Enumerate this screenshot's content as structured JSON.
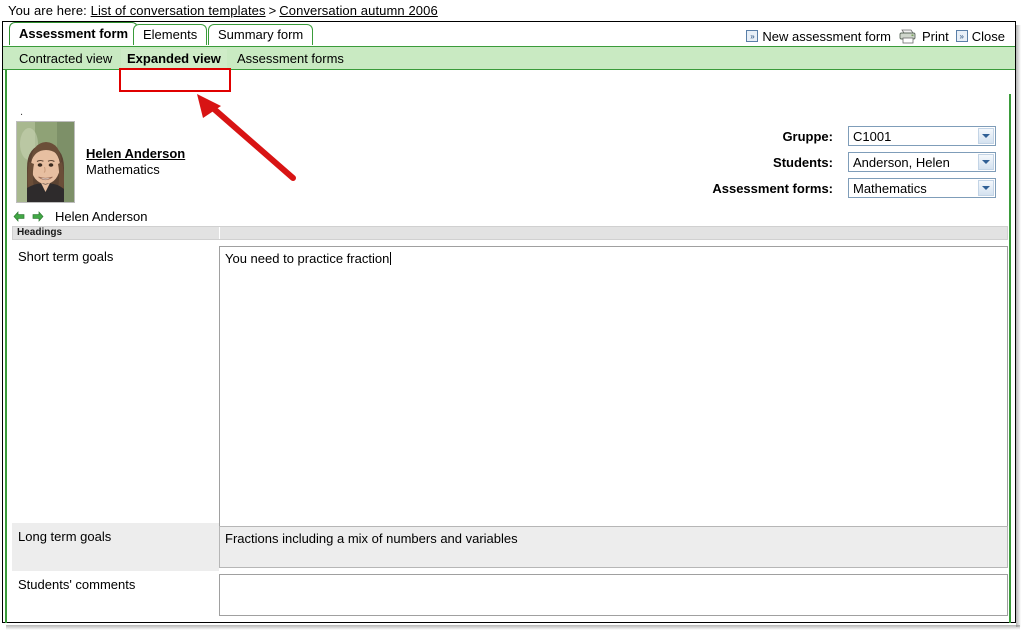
{
  "breadcrumb": {
    "prefix": "You are here:",
    "links": [
      "List of conversation templates",
      "Conversation autumn 2006"
    ],
    "separator": ">"
  },
  "tabs": [
    {
      "label": "Assessment form",
      "active": true
    },
    {
      "label": "Elements",
      "active": false
    },
    {
      "label": "Summary form",
      "active": false
    }
  ],
  "actions": [
    {
      "label": "New assessment form",
      "icon": "chevron-double-right-icon"
    },
    {
      "label": "Print",
      "icon": "printer-icon"
    },
    {
      "label": "Close",
      "icon": "chevron-double-right-icon"
    }
  ],
  "subnav": {
    "items": [
      {
        "label": "Contracted view",
        "highlighted": false
      },
      {
        "label": "Expanded view",
        "highlighted": true
      },
      {
        "label": "Assessment forms",
        "highlighted": false
      }
    ]
  },
  "annotation": {
    "color": "#e00000",
    "target": "Expanded view"
  },
  "student": {
    "dot": ".",
    "name": "Helen Anderson",
    "subject": "Mathematics",
    "avatar_alt": "Helen Anderson photo"
  },
  "selectors": [
    {
      "label": "Gruppe:",
      "value": "C1001"
    },
    {
      "label": "Students:",
      "value": "Anderson, Helen"
    },
    {
      "label": "Assessment forms:",
      "value": "Mathematics"
    }
  ],
  "pager": {
    "prev_icon": "arrow-left-icon",
    "next_icon": "arrow-right-icon",
    "current": "Helen Anderson"
  },
  "table": {
    "column_header": "Headings",
    "rows": [
      {
        "label": "Short term goals",
        "value": "You need to practice fraction",
        "focused": true,
        "readonly": false,
        "striped": false
      },
      {
        "label": "Long term goals",
        "value": "Fractions including a mix of numbers and variables",
        "focused": false,
        "readonly": true,
        "striped": true
      },
      {
        "label": "Students' comments",
        "value": "",
        "focused": false,
        "readonly": false,
        "striped": false
      }
    ]
  },
  "colors": {
    "accent_green": "#3a9b3a",
    "subnav_green": "#c9eac2",
    "annotation_red": "#e00000",
    "stripe_grey": "#ededed"
  }
}
